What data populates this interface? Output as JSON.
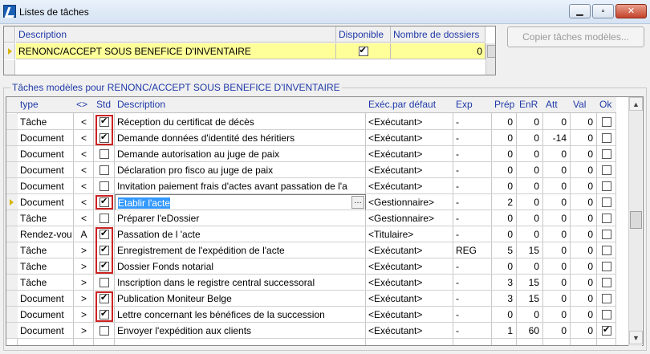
{
  "window": {
    "title": "Listes de tâches"
  },
  "top_grid": {
    "headers": {
      "description": "Description",
      "disponible": "Disponible",
      "nombre": "Nombre de dossiers"
    },
    "row": {
      "description": "RENONC/ACCEPT SOUS BENEFICE D'INVENTAIRE",
      "disponible": true,
      "nombre": "0"
    }
  },
  "copy_button": "Copier tâches modèles...",
  "group": {
    "title": "Tâches modèles pour RENONC/ACCEPT SOUS BENEFICE D'INVENTAIRE"
  },
  "grid": {
    "headers": {
      "type": "type",
      "dir": "<>",
      "std": "Std",
      "description": "Description",
      "exec": "Exéc.par défaut",
      "exp": "Exp",
      "prep": "Prép",
      "enr": "EnR",
      "att": "Att",
      "val": "Val",
      "ok": "Ok"
    },
    "rows": [
      {
        "type": "Tâche",
        "dir": "<",
        "std": true,
        "description": "Réception du certificat de décès",
        "exec": "<Exécutant>",
        "exp": "-",
        "prep": "0",
        "enr": "0",
        "att": "0",
        "val": "0",
        "ok": false
      },
      {
        "type": "Document",
        "dir": "<",
        "std": true,
        "description": "Demande données d'identité des héritiers",
        "exec": "<Exécutant>",
        "exp": "-",
        "prep": "0",
        "enr": "0",
        "att": "-14",
        "val": "0",
        "ok": false
      },
      {
        "type": "Document",
        "dir": "<",
        "std": false,
        "description": "Demande autorisation au juge de paix",
        "exec": "<Exécutant>",
        "exp": "-",
        "prep": "0",
        "enr": "0",
        "att": "0",
        "val": "0",
        "ok": false
      },
      {
        "type": "Document",
        "dir": "<",
        "std": false,
        "description": "Déclaration pro fisco au juge de paix",
        "exec": "<Exécutant>",
        "exp": "-",
        "prep": "0",
        "enr": "0",
        "att": "0",
        "val": "0",
        "ok": false
      },
      {
        "type": "Document",
        "dir": "<",
        "std": false,
        "description": "Invitation paiement frais d'actes avant passation de l'a",
        "exec": "<Exécutant>",
        "exp": "-",
        "prep": "0",
        "enr": "0",
        "att": "0",
        "val": "0",
        "ok": false
      },
      {
        "type": "Document",
        "dir": "<",
        "std": true,
        "description": "Etablir l'acte",
        "exec": "<Gestionnaire>",
        "exp": "-",
        "prep": "2",
        "enr": "0",
        "att": "0",
        "val": "0",
        "ok": false
      },
      {
        "type": "Tâche",
        "dir": "<",
        "std": false,
        "description": "Préparer l'eDossier",
        "exec": "<Gestionnaire>",
        "exp": "-",
        "prep": "0",
        "enr": "0",
        "att": "0",
        "val": "0",
        "ok": false
      },
      {
        "type": "Rendez-vou",
        "dir": "A",
        "std": true,
        "description": "Passation de l 'acte",
        "exec": "<Titulaire>",
        "exp": "-",
        "prep": "0",
        "enr": "0",
        "att": "0",
        "val": "0",
        "ok": false
      },
      {
        "type": "Tâche",
        "dir": ">",
        "std": true,
        "description": "Enregistrement de l'expédition de l'acte",
        "exec": "<Exécutant>",
        "exp": "REG",
        "prep": "5",
        "enr": "15",
        "att": "0",
        "val": "0",
        "ok": false
      },
      {
        "type": "Tâche",
        "dir": ">",
        "std": true,
        "description": "Dossier Fonds notarial",
        "exec": "<Exécutant>",
        "exp": "-",
        "prep": "0",
        "enr": "0",
        "att": "0",
        "val": "0",
        "ok": false
      },
      {
        "type": "Tâche",
        "dir": ">",
        "std": false,
        "description": "Inscription dans le registre central successoral",
        "exec": "<Exécutant>",
        "exp": "-",
        "prep": "3",
        "enr": "15",
        "att": "0",
        "val": "0",
        "ok": false
      },
      {
        "type": "Document",
        "dir": ">",
        "std": true,
        "description": "Publication Moniteur Belge",
        "exec": "<Exécutant>",
        "exp": "-",
        "prep": "3",
        "enr": "15",
        "att": "0",
        "val": "0",
        "ok": false
      },
      {
        "type": "Document",
        "dir": ">",
        "std": true,
        "description": "Lettre concernant les bénéfices de la succession",
        "exec": "<Exécutant>",
        "exp": "-",
        "prep": "0",
        "enr": "0",
        "att": "0",
        "val": "0",
        "ok": false
      },
      {
        "type": "Document",
        "dir": ">",
        "std": false,
        "description": "Envoyer l'expédition aux clients",
        "exec": "<Exécutant>",
        "exp": "-",
        "prep": "1",
        "enr": "60",
        "att": "0",
        "val": "0",
        "ok": true
      }
    ]
  }
}
